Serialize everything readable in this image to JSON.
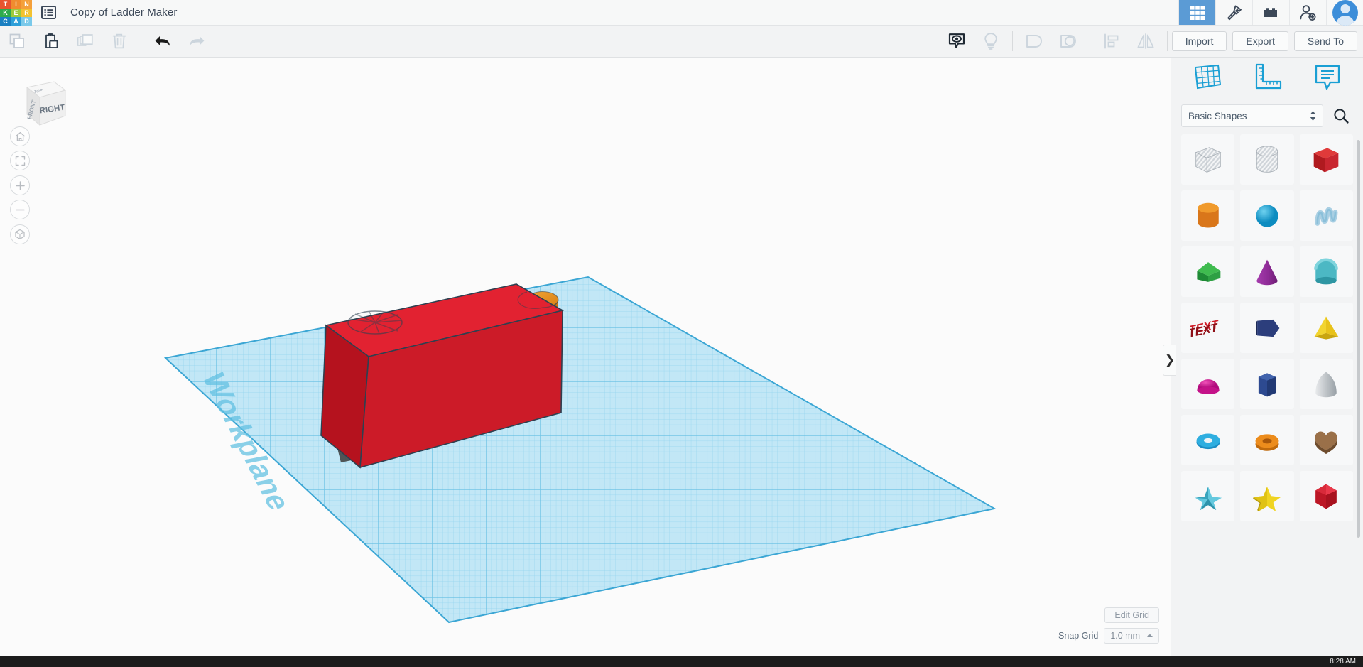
{
  "app": {
    "name": "Tinkercad",
    "logo_tiles": [
      {
        "letter": "T",
        "color": "#e8542f"
      },
      {
        "letter": "I",
        "color": "#f08c2e"
      },
      {
        "letter": "N",
        "color": "#f4a03a"
      },
      {
        "letter": "K",
        "color": "#2eab4b"
      },
      {
        "letter": "E",
        "color": "#9ec93c"
      },
      {
        "letter": "R",
        "color": "#f2c230"
      },
      {
        "letter": "C",
        "color": "#1a7fc1"
      },
      {
        "letter": "A",
        "color": "#2d9fd9"
      },
      {
        "letter": "D",
        "color": "#7ac9ea"
      }
    ],
    "document_title": "Copy of Ladder Maker",
    "doc_menu_icon": "list-menu-icon"
  },
  "topbar_right": {
    "items": [
      {
        "name": "gallery-grid-icon",
        "label": "Gallery",
        "active": true
      },
      {
        "name": "tinker-hammer-icon",
        "label": "Tinker",
        "active": false
      },
      {
        "name": "blocks-brick-icon",
        "label": "Blocks",
        "active": false
      },
      {
        "name": "invite-person-icon",
        "label": "Invite",
        "active": false
      }
    ],
    "avatar": "user-avatar"
  },
  "toolbar": {
    "left_tools": [
      {
        "name": "copy-button",
        "label": "Copy",
        "enabled": true
      },
      {
        "name": "paste-button",
        "label": "Paste",
        "enabled": true
      },
      {
        "name": "duplicate-button",
        "label": "Duplicate",
        "enabled": false
      },
      {
        "name": "delete-button",
        "label": "Delete",
        "enabled": false
      }
    ],
    "history_tools": [
      {
        "name": "undo-button",
        "label": "Undo",
        "enabled": true
      },
      {
        "name": "redo-button",
        "label": "Redo",
        "enabled": false
      }
    ],
    "right_tools": [
      {
        "name": "show-hide-button",
        "label": "Show/Hide",
        "enabled": true
      },
      {
        "name": "light-button",
        "label": "Light",
        "enabled": false
      },
      {
        "name": "group-button",
        "label": "Group",
        "enabled": false
      },
      {
        "name": "ungroup-button",
        "label": "Ungroup",
        "enabled": false
      },
      {
        "name": "align-button",
        "label": "Align",
        "enabled": false
      },
      {
        "name": "mirror-button",
        "label": "Mirror",
        "enabled": false
      }
    ],
    "import_label": "Import",
    "export_label": "Export",
    "sendto_label": "Send To"
  },
  "canvas": {
    "viewcube": {
      "face_front": "RIGHT",
      "face_left": "FRONT",
      "face_top": "TOP"
    },
    "nav_buttons": [
      {
        "name": "home-view-button",
        "label": "Home view"
      },
      {
        "name": "fit-to-view-button",
        "label": "Fit all in view"
      },
      {
        "name": "zoom-in-button",
        "label": "Zoom in"
      },
      {
        "name": "zoom-out-button",
        "label": "Zoom out"
      },
      {
        "name": "perspective-toggle-button",
        "label": "Switch to orthographic view"
      }
    ],
    "workplane_label": "Workplane",
    "objects": [
      {
        "name": "red-box",
        "color": "#d61f2a",
        "type": "box"
      },
      {
        "name": "orange-cylinder",
        "color": "#e08a1e",
        "type": "cylinder"
      }
    ],
    "grid_color": "#bfe6f5",
    "grid_line_color": "#56b8e0"
  },
  "grid_controls": {
    "edit_grid_label": "Edit Grid",
    "snap_grid_label": "Snap Grid",
    "snap_grid_value": "1.0 mm",
    "snap_caret": "snap-caret-up-icon"
  },
  "panel_toggle": {
    "icon": "chevron-right-icon",
    "glyph": "❯"
  },
  "right_panel": {
    "tabs": [
      {
        "name": "tab-shapes-workplane",
        "label": "Workplane",
        "icon": "grid-workplane-icon"
      },
      {
        "name": "tab-ruler",
        "label": "Ruler",
        "icon": "ruler-icon"
      },
      {
        "name": "tab-notes",
        "label": "Notes",
        "icon": "note-callout-icon"
      }
    ],
    "shape_category": "Basic Shapes",
    "search_icon": "search-icon",
    "dropdown_icon": "updown-caret-icon",
    "shapes": [
      {
        "name": "shape-box-hole",
        "label": "Box Hole",
        "icon": "box-hole-icon"
      },
      {
        "name": "shape-cylinder-hole",
        "label": "Cylinder Hole",
        "icon": "cylinder-hole-icon"
      },
      {
        "name": "shape-box",
        "label": "Box",
        "icon": "box-icon"
      },
      {
        "name": "shape-cylinder",
        "label": "Cylinder",
        "icon": "cylinder-icon"
      },
      {
        "name": "shape-sphere",
        "label": "Sphere",
        "icon": "sphere-icon"
      },
      {
        "name": "shape-scribble",
        "label": "Scribble",
        "icon": "scribble-icon"
      },
      {
        "name": "shape-roof",
        "label": "Roof",
        "icon": "roof-icon"
      },
      {
        "name": "shape-cone",
        "label": "Cone",
        "icon": "cone-icon"
      },
      {
        "name": "shape-tube",
        "label": "Tube",
        "icon": "half-tube-icon"
      },
      {
        "name": "shape-text",
        "label": "Text",
        "icon": "text-3d-icon"
      },
      {
        "name": "shape-polygon-arrow",
        "label": "Polygon",
        "icon": "polygon-arrow-icon"
      },
      {
        "name": "shape-pyramid",
        "label": "Pyramid",
        "icon": "pyramid-icon"
      },
      {
        "name": "shape-half-sphere",
        "label": "Half Sphere",
        "icon": "half-sphere-icon"
      },
      {
        "name": "shape-hexagon-prism",
        "label": "Hexagon",
        "icon": "hexagon-prism-icon"
      },
      {
        "name": "shape-paraboloid",
        "label": "Paraboloid",
        "icon": "paraboloid-icon"
      },
      {
        "name": "shape-torus",
        "label": "Torus",
        "icon": "torus-icon"
      },
      {
        "name": "shape-round-roof",
        "label": "Round Tube",
        "icon": "round-tube-icon"
      },
      {
        "name": "shape-heart",
        "label": "Heart",
        "icon": "heart-icon"
      },
      {
        "name": "shape-star-teal",
        "label": "Star",
        "icon": "star-3d-icon"
      },
      {
        "name": "shape-star-yellow",
        "label": "Star",
        "icon": "star-flat-icon"
      },
      {
        "name": "shape-diamond",
        "label": "Diamond",
        "icon": "diamond-icon"
      }
    ]
  },
  "taskbar": {
    "clock": "8:28 AM"
  }
}
